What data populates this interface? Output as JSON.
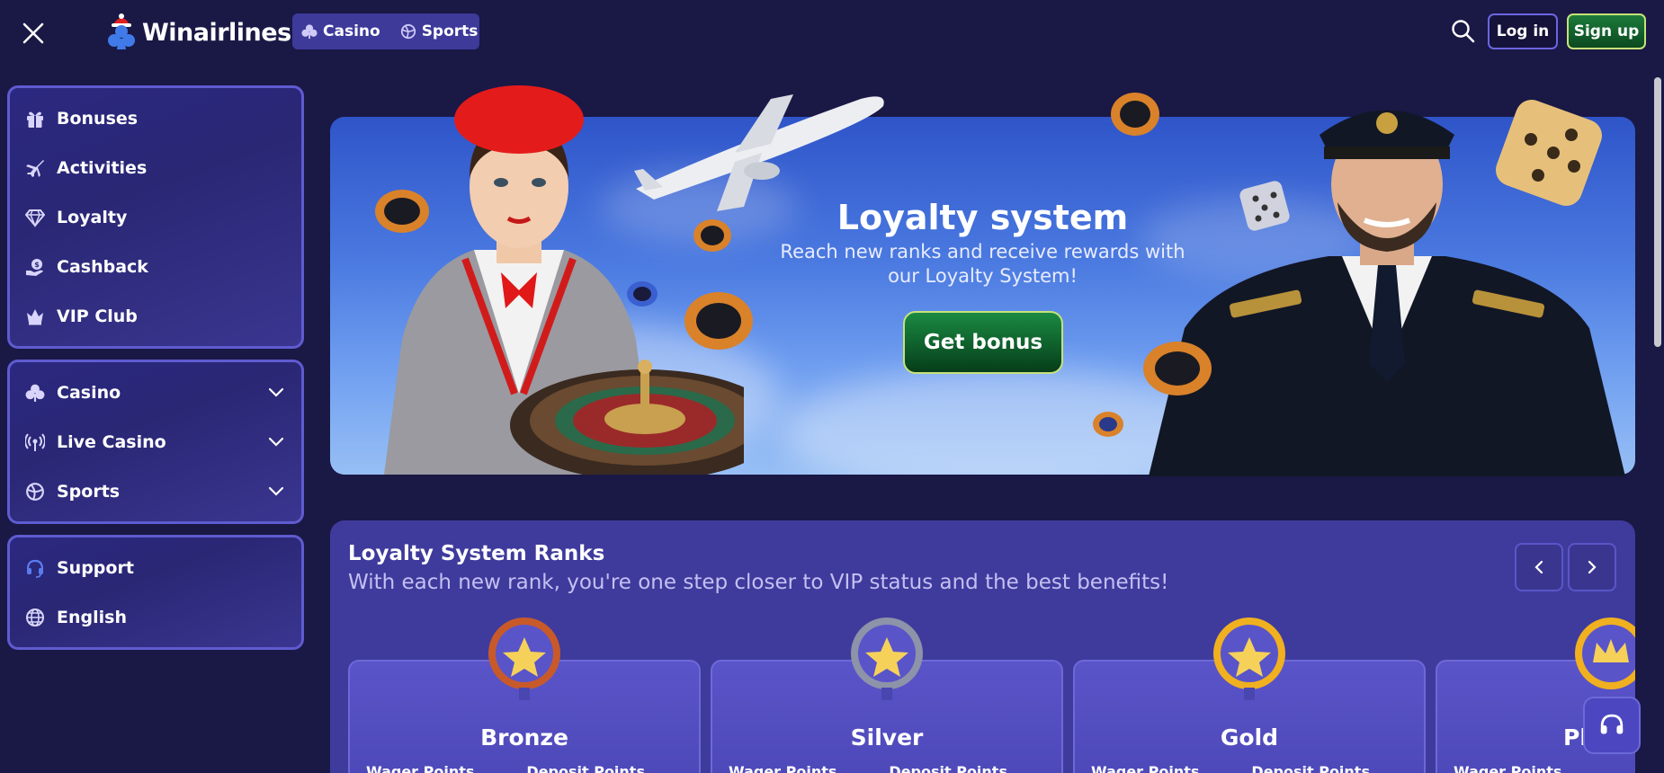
{
  "header": {
    "logo_text": "Winairlines",
    "modes": [
      {
        "label": "Casino",
        "icon": "club-icon"
      },
      {
        "label": "Sports",
        "icon": "sports-ball-icon"
      }
    ],
    "login_label": "Log in",
    "signup_label": "Sign up"
  },
  "sidebar": {
    "primary": [
      {
        "label": "Bonuses",
        "icon": "gift-icon"
      },
      {
        "label": "Activities",
        "icon": "airplane-icon"
      },
      {
        "label": "Loyalty",
        "icon": "diamond-icon"
      },
      {
        "label": "Cashback",
        "icon": "cashback-icon"
      },
      {
        "label": "VIP Club",
        "icon": "crown-icon"
      }
    ],
    "categories": [
      {
        "label": "Casino",
        "icon": "club-icon"
      },
      {
        "label": "Live Casino",
        "icon": "live-broadcast-icon"
      },
      {
        "label": "Sports",
        "icon": "sports-ball-icon"
      }
    ],
    "utility": [
      {
        "label": "Support",
        "icon": "headset-icon"
      },
      {
        "label": "English",
        "icon": "globe-icon"
      }
    ]
  },
  "banner": {
    "title": "Loyalty system",
    "subtitle": "Reach new ranks and receive rewards with our Loyalty System!",
    "cta_label": "Get bonus"
  },
  "ranks": {
    "title": "Loyalty System Ranks",
    "subtitle": "With each new rank, you're one step closer to VIP status and the best benefits!",
    "cards": [
      {
        "name": "Bronze",
        "wager_label": "Wager Points",
        "deposit_label": "Deposit Points",
        "ring_color": "#c85a2a"
      },
      {
        "name": "Silver",
        "wager_label": "Wager Points",
        "deposit_label": "Deposit Points",
        "ring_color": "#8d93a8"
      },
      {
        "name": "Gold",
        "wager_label": "Wager Points",
        "deposit_label": "Deposit Points",
        "ring_color": "#f0b020"
      },
      {
        "name": "Pl",
        "wager_label": "Wager Points",
        "deposit_label": "",
        "ring_color": "#f0b020"
      }
    ]
  },
  "colors": {
    "background": "#1a1845",
    "panel": "#3f3b9c",
    "accent": "#5f5bd0",
    "cta_green": "#1a8a42"
  }
}
